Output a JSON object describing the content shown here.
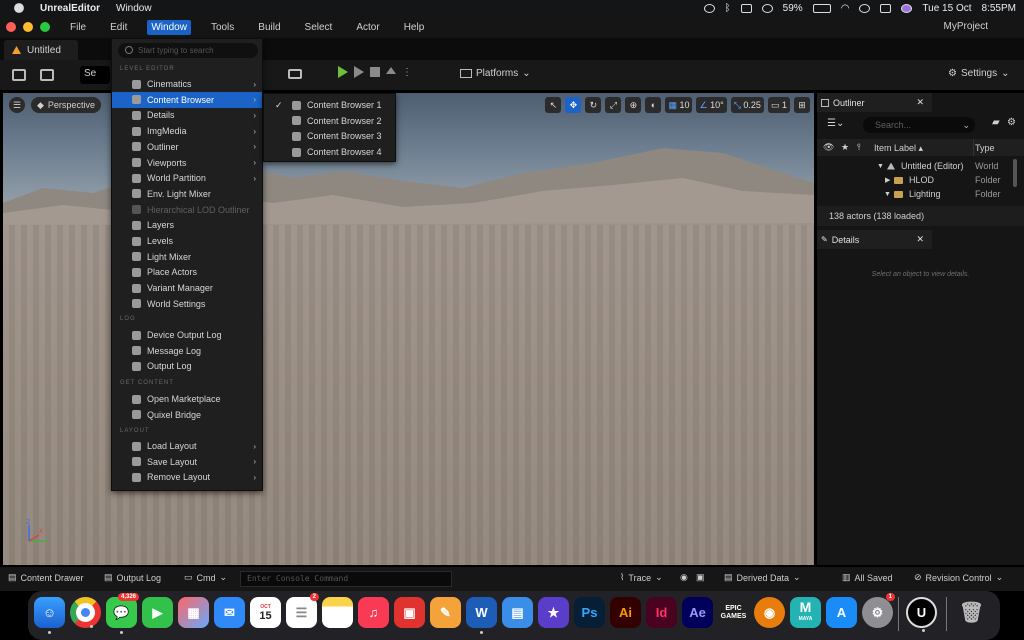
{
  "macos_menubar": {
    "app_name": "UnrealEditor",
    "menus": [
      "Window"
    ],
    "battery": "59%",
    "date": "Tue 15 Oct",
    "time": "8:55PM"
  },
  "editor_menubar": {
    "menus": [
      "File",
      "Edit",
      "Window",
      "Tools",
      "Build",
      "Select",
      "Actor",
      "Help"
    ],
    "selected_menu": "Window",
    "project_name": "MyProject"
  },
  "document_tab": {
    "label": "Untitled"
  },
  "toolbar": {
    "select_mode_label": "Se",
    "platforms_label": "Platforms",
    "settings_label": "Settings"
  },
  "viewport": {
    "perspective_label": "Perspective",
    "grid_snap": "10",
    "rotation_snap": "10°",
    "scale_snap": "0.25",
    "camera_speed": "1"
  },
  "window_menu": {
    "search_placeholder": "Start typing to search",
    "sections": {
      "level_editor": "LEVEL EDITOR",
      "log": "LOG",
      "get_content": "GET CONTENT",
      "layout": "LAYOUT"
    },
    "level_editor_items": [
      {
        "label": "Cinematics",
        "submenu": true,
        "disabled": false,
        "highlighted": false
      },
      {
        "label": "Content Browser",
        "submenu": true,
        "disabled": false,
        "highlighted": true
      },
      {
        "label": "Details",
        "submenu": true,
        "disabled": false,
        "highlighted": false
      },
      {
        "label": "ImgMedia",
        "submenu": true,
        "disabled": false,
        "highlighted": false
      },
      {
        "label": "Outliner",
        "submenu": true,
        "disabled": false,
        "highlighted": false
      },
      {
        "label": "Viewports",
        "submenu": true,
        "disabled": false,
        "highlighted": false
      },
      {
        "label": "World Partition",
        "submenu": true,
        "disabled": false,
        "highlighted": false
      },
      {
        "label": "Env. Light Mixer",
        "submenu": false,
        "disabled": false,
        "highlighted": false
      },
      {
        "label": "Hierarchical LOD Outliner",
        "submenu": false,
        "disabled": true,
        "highlighted": false
      },
      {
        "label": "Layers",
        "submenu": false,
        "disabled": false,
        "highlighted": false
      },
      {
        "label": "Levels",
        "submenu": false,
        "disabled": false,
        "highlighted": false
      },
      {
        "label": "Light Mixer",
        "submenu": false,
        "disabled": false,
        "highlighted": false
      },
      {
        "label": "Place Actors",
        "submenu": false,
        "disabled": false,
        "highlighted": false
      },
      {
        "label": "Variant Manager",
        "submenu": false,
        "disabled": false,
        "highlighted": false
      },
      {
        "label": "World Settings",
        "submenu": false,
        "disabled": false,
        "highlighted": false
      }
    ],
    "log_items": [
      {
        "label": "Device Output Log"
      },
      {
        "label": "Message Log"
      },
      {
        "label": "Output Log"
      }
    ],
    "get_content_items": [
      {
        "label": "Open Marketplace"
      },
      {
        "label": "Quixel Bridge"
      }
    ],
    "layout_items": [
      {
        "label": "Load Layout",
        "submenu": true
      },
      {
        "label": "Save Layout",
        "submenu": true
      },
      {
        "label": "Remove Layout",
        "submenu": true
      }
    ]
  },
  "content_browser_submenu": {
    "items": [
      {
        "label": "Content Browser 1",
        "checked": true
      },
      {
        "label": "Content Browser 2",
        "checked": false
      },
      {
        "label": "Content Browser 3",
        "checked": false
      },
      {
        "label": "Content Browser 4",
        "checked": false
      }
    ]
  },
  "outliner": {
    "tab_label": "Outliner",
    "search_placeholder": "Search...",
    "columns": {
      "item_label": "Item Label",
      "type": "Type"
    },
    "rows": [
      {
        "name": "Untitled (Editor)",
        "type": "World"
      },
      {
        "name": "HLOD",
        "type": "Folder"
      },
      {
        "name": "Lighting",
        "type": "Folder"
      }
    ],
    "actor_count": "138 actors (138 loaded)"
  },
  "details": {
    "tab_label": "Details",
    "empty_message": "Select an object to view details."
  },
  "statusbar": {
    "content_drawer": "Content Drawer",
    "output_log": "Output Log",
    "cmd": "Cmd",
    "console_placeholder": "Enter Console Command",
    "trace": "Trace",
    "derived_data": "Derived Data",
    "all_saved": "All Saved",
    "revision_control": "Revision Control"
  },
  "dock": {
    "messages_badge": "4,326",
    "reminders_badge": "2",
    "settings_badge": "1",
    "calendar_month": "OCT",
    "calendar_day": "15",
    "labels": {
      "photoshop": "Ps",
      "illustrator": "Ai",
      "indesign": "Id",
      "after_effects": "Ae",
      "word": "W",
      "epic_games": "EPIC\nGAMES",
      "maya": "MAYA"
    }
  }
}
